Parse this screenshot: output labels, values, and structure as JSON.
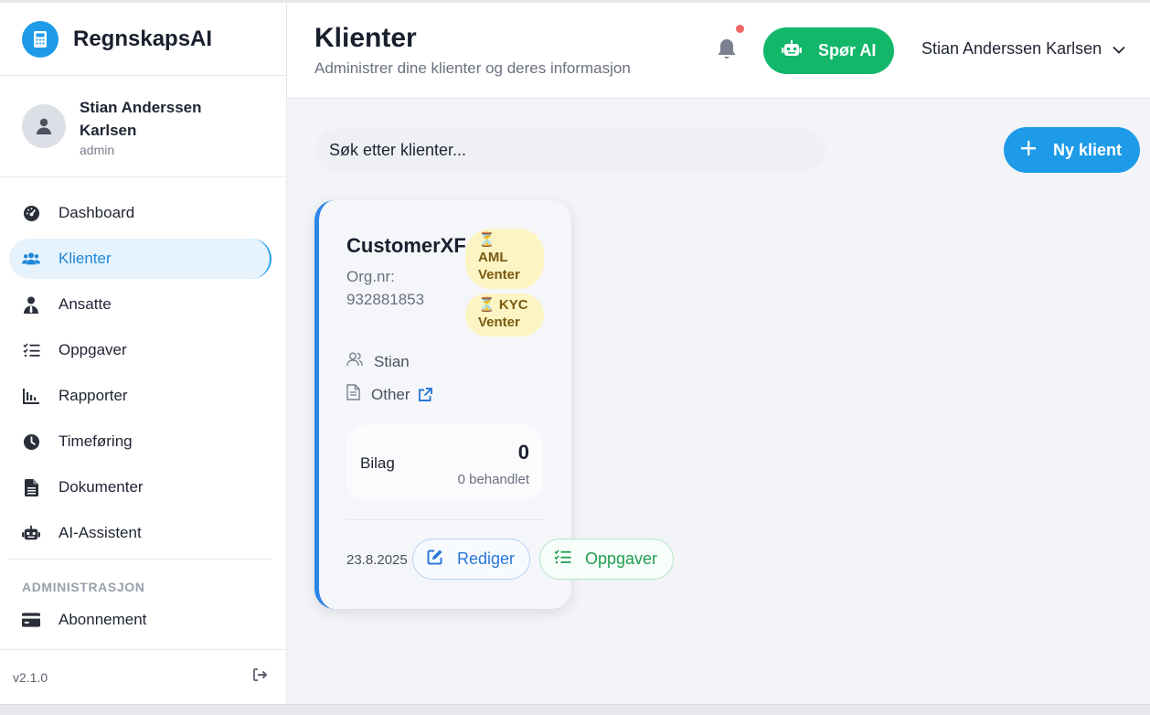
{
  "brand": {
    "name": "RegnskapsAI",
    "logo_icon": "calculator-icon"
  },
  "user": {
    "name": "Stian Anderssen Karlsen",
    "role": "admin"
  },
  "sidebar": {
    "items": [
      {
        "label": "Dashboard",
        "icon": "gauge-icon",
        "active": false
      },
      {
        "label": "Klienter",
        "icon": "users-icon",
        "active": true
      },
      {
        "label": "Ansatte",
        "icon": "user-tie-icon",
        "active": false
      },
      {
        "label": "Oppgaver",
        "icon": "list-check-icon",
        "active": false
      },
      {
        "label": "Rapporter",
        "icon": "bar-chart-icon",
        "active": false
      },
      {
        "label": "Timeføring",
        "icon": "clock-icon",
        "active": false
      },
      {
        "label": "Dokumenter",
        "icon": "file-icon",
        "active": false
      },
      {
        "label": "AI-Assistent",
        "icon": "robot-icon",
        "active": false
      }
    ],
    "section_label": "ADMINISTRASJON",
    "admin_items": [
      {
        "label": "Abonnement",
        "icon": "credit-card-icon"
      }
    ],
    "version": "v2.1.0"
  },
  "header": {
    "title": "Klienter",
    "subtitle": "Administrer dine klienter og deres informasjon",
    "ask_ai_label": "Spør AI",
    "user_menu_label": "Stian Anderssen Karlsen"
  },
  "toolbar": {
    "search_placeholder": "Søk etter klienter...",
    "new_client_label": "Ny klient"
  },
  "client_card": {
    "name": "CustomerXF",
    "org_label": "Org.nr:",
    "org_number": "932881853",
    "badges": [
      {
        "icon": "⏳",
        "line1": "AML",
        "line2": "Venter"
      },
      {
        "icon": "⏳",
        "line1": "KYC",
        "line2": "Venter"
      }
    ],
    "owner": "Stian",
    "type": "Other",
    "stats_label": "Bilag",
    "stats_value": "0",
    "stats_sub": "0 behandlet",
    "date": "23.8.2025",
    "edit_label": "Rediger",
    "tasks_label": "Oppgaver"
  },
  "colors": {
    "accent": "#1e9be8",
    "ai_green": "#12b76a",
    "badge_bg": "#fdf4c3",
    "notification_dot": "#f06565"
  }
}
